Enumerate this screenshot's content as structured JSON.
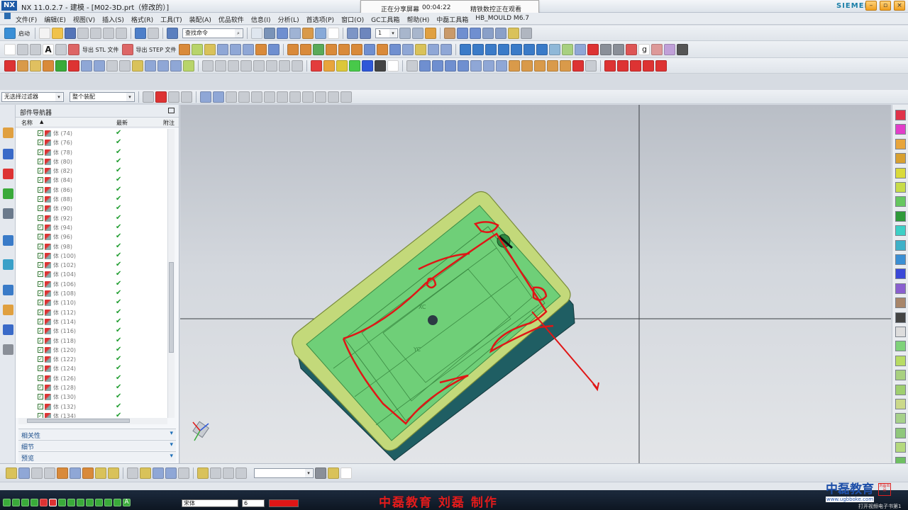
{
  "window": {
    "logo": "NX",
    "title": "NX 11.0.2.7 - 建模 - [M02-3D.prt（修改的）]",
    "brand": "SIEMENS"
  },
  "share_banner": {
    "status": "正在分享屏幕",
    "elapsed": "00:04:22",
    "viewer_note": "精铁数控正在观看"
  },
  "menu": [
    "文件(F)",
    "编辑(E)",
    "视图(V)",
    "插入(S)",
    "格式(R)",
    "工具(T)",
    "装配(A)",
    "优品软件",
    "信息(I)",
    "分析(L)",
    "首选项(P)",
    "窗口(O)",
    "GC工具箱",
    "帮助(H)",
    "中磊工具箱",
    "HB_MOULD M6.7"
  ],
  "toolbar1": {
    "start_label": "启动",
    "command_search_placeholder": "查找命令",
    "layer_value": "1"
  },
  "toolbar2": {
    "export_stl": "导出 STL 文件",
    "export_step": "导出 STEP 文件"
  },
  "selection_bar": {
    "filter_value": "无选择过滤器",
    "scope_value": "整个装配"
  },
  "part_navigator": {
    "title": "部件导航器",
    "col_name": "名称",
    "col_latest": "最新",
    "col_note": "附注",
    "rows": [
      {
        "label": "体 (74)"
      },
      {
        "label": "体 (76)"
      },
      {
        "label": "体 (78)"
      },
      {
        "label": "体 (80)"
      },
      {
        "label": "体 (82)"
      },
      {
        "label": "体 (84)"
      },
      {
        "label": "体 (86)"
      },
      {
        "label": "体 (88)"
      },
      {
        "label": "体 (90)"
      },
      {
        "label": "体 (92)"
      },
      {
        "label": "体 (94)"
      },
      {
        "label": "体 (96)"
      },
      {
        "label": "体 (98)"
      },
      {
        "label": "体 (100)"
      },
      {
        "label": "体 (102)"
      },
      {
        "label": "体 (104)"
      },
      {
        "label": "体 (106)"
      },
      {
        "label": "体 (108)"
      },
      {
        "label": "体 (110)"
      },
      {
        "label": "体 (112)"
      },
      {
        "label": "体 (114)"
      },
      {
        "label": "体 (116)"
      },
      {
        "label": "体 (118)"
      },
      {
        "label": "体 (120)"
      },
      {
        "label": "体 (122)"
      },
      {
        "label": "体 (124)"
      },
      {
        "label": "体 (126)"
      },
      {
        "label": "体 (128)"
      },
      {
        "label": "体 (130)"
      },
      {
        "label": "体 (132)"
      },
      {
        "label": "体 (134)"
      }
    ],
    "panels": [
      "相关性",
      "细节",
      "预览"
    ]
  },
  "viewport": {
    "axis_labels": [
      "XC",
      "YC"
    ]
  },
  "palette_colors": [
    "#e0334a",
    "#e23ec9",
    "#e8a53c",
    "#d8a030",
    "#dada3a",
    "#c8dc4a",
    "#66c760",
    "#2f9a3a",
    "#3dd0c6",
    "#3fb1c8",
    "#3b8fd4",
    "#3a48d8",
    "#8a5fcf",
    "#a8866a",
    "#444444",
    "#dddddd",
    "#7fd27a",
    "#b8dc64",
    "#a8d080",
    "#9fcf70",
    "#cbd98a",
    "#a6d18a",
    "#8fc77c",
    "#b4d97e",
    "#6fbf62"
  ],
  "toolbar_colors": [
    "#e33c3c",
    "#e8a53c",
    "#dcc73a",
    "#48c94a",
    "#2f58d8",
    "#444444",
    "#ffffff"
  ],
  "taskbar": {
    "font_value": "宋体",
    "size_value": "6"
  },
  "watermark": "中磊教育  刘磊  制作",
  "brand_box": {
    "name": "中磊教育",
    "seal": "刘磊出品",
    "url": "www.ugbboke.com",
    "note": "打开视频电子书第1"
  }
}
